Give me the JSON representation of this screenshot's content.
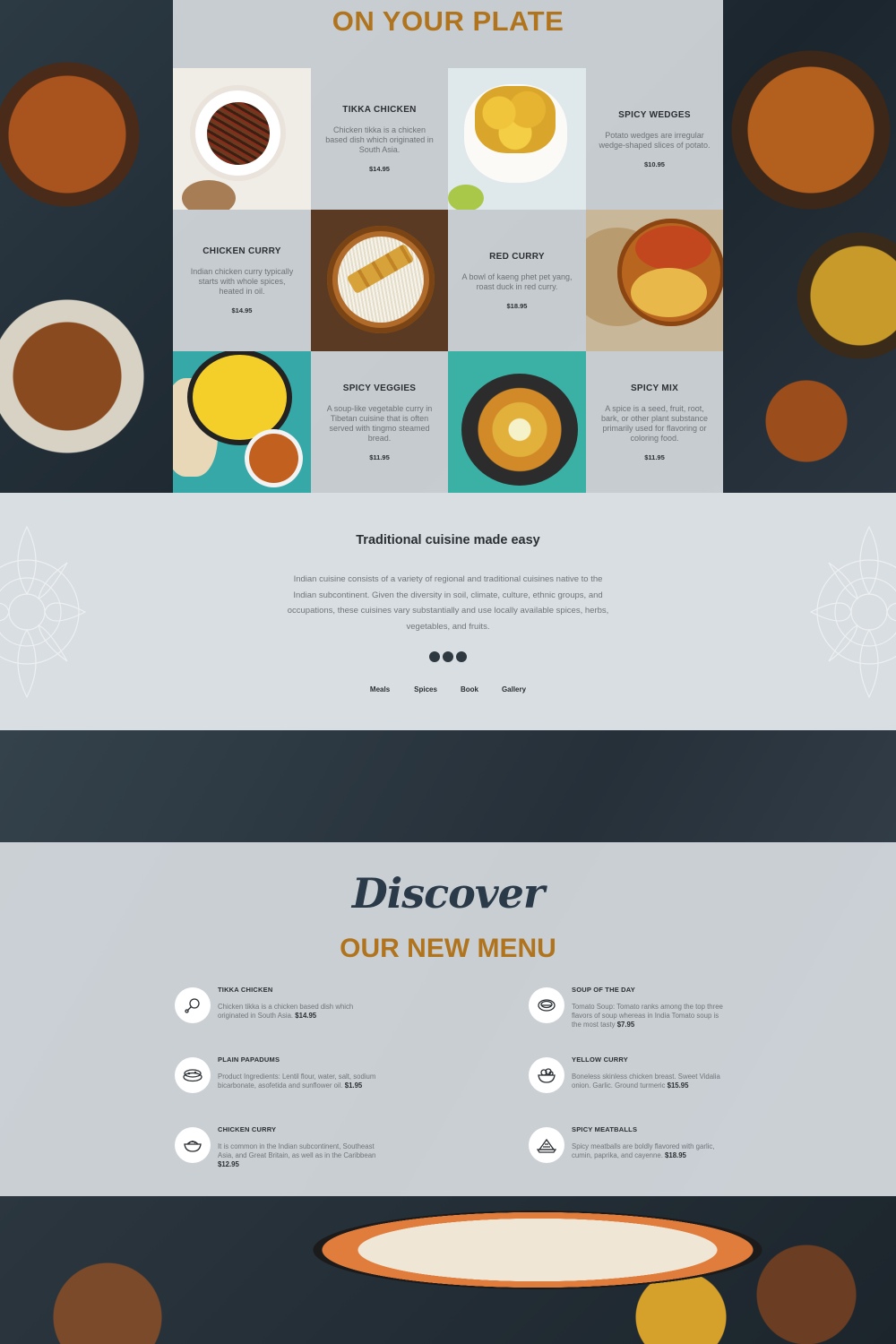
{
  "plate": {
    "title": "ON YOUR PLATE",
    "items": [
      {
        "name": "TIKKA CHICKEN",
        "desc": "Chicken tikka is a chicken based dish which originated in South Asia.",
        "price": "$14.95"
      },
      {
        "name": "SPICY WEDGES",
        "desc": "Potato wedges are irregular wedge-shaped slices of potato.",
        "price": "$10.95"
      },
      {
        "name": "CHICKEN CURRY",
        "desc": "Indian chicken curry typically starts with whole spices, heated in oil.",
        "price": "$14.95"
      },
      {
        "name": "RED CURRY",
        "desc": "A bowl of kaeng phet pet yang, roast duck in red curry.",
        "price": "$18.95"
      },
      {
        "name": "SPICY VEGGIES",
        "desc": "A soup-like vegetable curry in Tibetan cuisine that is often served with tingmo steamed bread.",
        "price": "$11.95"
      },
      {
        "name": "SPICY MIX",
        "desc": "A spice is a seed, fruit, root, bark, or other plant substance primarily used for flavoring or coloring food.",
        "price": "$11.95"
      }
    ]
  },
  "traditional": {
    "title": "Traditional cuisine made easy",
    "body": "Indian cuisine consists of a variety of regional and traditional cuisines native to the Indian subcontinent. Given the diversity in soil, climate, culture, ethnic groups, and occupations, these cuisines vary substantially and use locally available spices, herbs, vegetables, and fruits.",
    "nav": [
      "Meals",
      "Spices",
      "Book",
      "Gallery"
    ]
  },
  "discover": {
    "script": "Discover",
    "title": "OUR NEW MENU",
    "left": [
      {
        "name": "TIKKA CHICKEN",
        "desc": "Chicken tikka is a chicken based dish which originated in South Asia.",
        "price": "$14.95",
        "icon": "drumstick-icon"
      },
      {
        "name": "PLAIN PAPADUMS",
        "desc": "Product Ingredients: Lentil flour, water, salt, sodium bicarbonate, asofetida and sunflower oil.",
        "price": "$1.95",
        "icon": "papadum-icon"
      },
      {
        "name": "CHICKEN CURRY",
        "desc": "It is common in the Indian subcontinent, Southeast Asia, and Great Britain, as well as in the Caribbean",
        "price": "$12.95",
        "icon": "curry-bowl-icon"
      }
    ],
    "right": [
      {
        "name": "SOUP OF THE DAY",
        "desc": "Tomato Soup: Tomato ranks among the top three flavors of soup whereas in India Tomato soup is the most tasty",
        "price": "$7.95",
        "icon": "soup-icon"
      },
      {
        "name": "YELLOW CURRY",
        "desc": "Boneless skinless chicken breast. Sweet Vidalia onion. Garlic. Ground turmeric",
        "price": "$15.95",
        "icon": "yellow-curry-icon"
      },
      {
        "name": "SPICY MEATBALLS",
        "desc": "Spicy meatballs are boldly flavored with garlic, cumin, paprika, and cayenne.",
        "price": "$18.95",
        "icon": "meatballs-icon"
      }
    ]
  },
  "colors": {
    "accent": "#b0741e",
    "heading": "#2a2f33",
    "script": "#2b3a48"
  }
}
